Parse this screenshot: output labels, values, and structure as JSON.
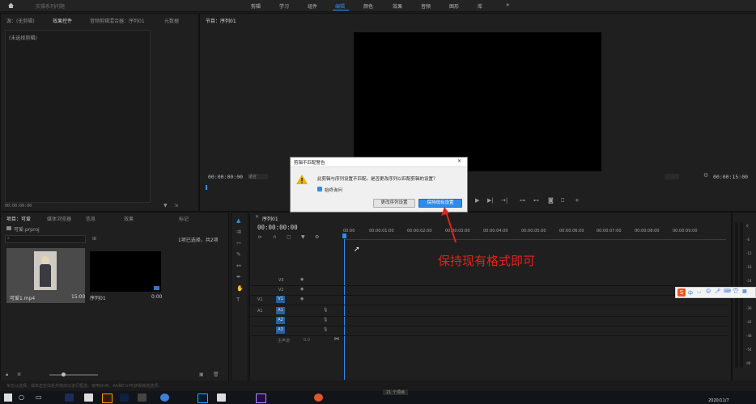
{
  "titlebar": {
    "project": "实操系列问题"
  },
  "workspaces": [
    {
      "label": "剪辑",
      "active": false
    },
    {
      "label": "学习",
      "active": false
    },
    {
      "label": "组件",
      "active": false
    },
    {
      "label": "编辑",
      "active": true
    },
    {
      "label": "颜色",
      "active": false
    },
    {
      "label": "效果",
      "active": false
    },
    {
      "label": "音频",
      "active": false
    },
    {
      "label": "图形",
      "active": false
    },
    {
      "label": "库",
      "active": false
    }
  ],
  "source_panel": {
    "tabs": [
      "源：(无剪辑)",
      "效果控件",
      "音频剪辑混合器：序列01",
      "元数据"
    ],
    "no_clip": "(未选择剪辑)",
    "timecode": "00:00:00:00"
  },
  "program_panel": {
    "title": "节目：序列01",
    "timecode_left": "00:00:00:00",
    "fit": "适合",
    "timecode_right": "00:00:15:00"
  },
  "project_panel": {
    "tabs": [
      "项目：可爱",
      "媒体浏览器",
      "信息",
      "效果",
      "标记"
    ],
    "project_file": "可爱.prproj",
    "selection_status": "1项已选择，共2项",
    "items": [
      {
        "name": "可爱1.mp4",
        "duration": "15:00"
      },
      {
        "name": "序列01",
        "duration": "0:00"
      }
    ]
  },
  "timeline": {
    "title": "序列01",
    "timecode": "00:00:00:00",
    "ruler": [
      "00:00",
      "00:00:01:00",
      "00:00:02:00",
      "00:00:03:00",
      "00:00:04:00",
      "00:00:05:00",
      "00:00:06:00",
      "00:00:07:00",
      "00:00:08:00",
      "00:00:09:00"
    ],
    "video_tracks": [
      "V3",
      "V2",
      "V1"
    ],
    "audio_tracks": [
      "A1",
      "A2",
      "A3"
    ],
    "source_patch": {
      "video": "V1",
      "audio": "A1"
    },
    "master": "主声道",
    "master_value": "0.0"
  },
  "dialog": {
    "title": "剪辑不匹配警告",
    "message": "此剪辑与序列设置不匹配。是否更改序列以匹配剪辑的设置？",
    "checkbox_label": "始终询问",
    "btn_change": "更改序列设置",
    "btn_keep": "保持现有设置"
  },
  "annotation": {
    "text": "保持现有格式即可",
    "color": "#e0231c"
  },
  "meter": {
    "labels": [
      "0",
      "-6",
      "-12",
      "-18",
      "-24",
      "-30",
      "-36",
      "-42",
      "-48",
      "-54",
      "dB"
    ]
  },
  "ime": {
    "label": "中"
  },
  "statusbar": {
    "text": "单击以选择，或单击空白处并拖动以进行框选。使用Shift、Alt和Ctrl可获得其他选项。"
  },
  "taskbar": {
    "date": "2020/11/7",
    "label": "21 个项目"
  },
  "colors": {
    "accent": "#2d8ceb",
    "warn": "#e0231c",
    "bg": "#1d1d1d"
  }
}
